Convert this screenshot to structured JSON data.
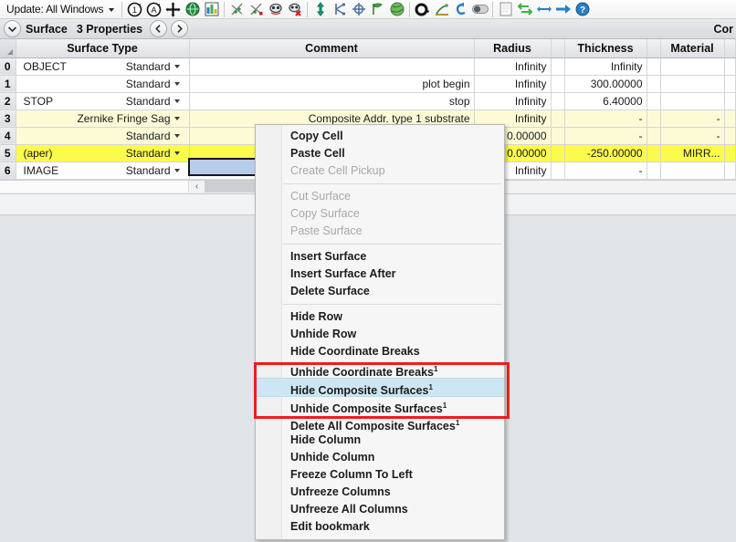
{
  "toolbar": {
    "update_label": "Update: All Windows",
    "icons": [
      {
        "name": "update-all-icon"
      },
      {
        "name": "update-all-windows-icon"
      },
      {
        "name": "move-crosshair-icon"
      },
      {
        "name": "globe-icon"
      },
      {
        "name": "layout-plot-icon"
      },
      {
        "name": "scatter-green-icon"
      },
      {
        "name": "scatter-red-icon"
      },
      {
        "name": "lens-draw-icon"
      },
      {
        "name": "lens-draw-delete-icon"
      },
      {
        "name": "ray-aim-icon"
      },
      {
        "name": "ray-split-icon"
      },
      {
        "name": "polarization-icon"
      },
      {
        "name": "flag-icon"
      },
      {
        "name": "coating-globe-icon"
      },
      {
        "name": "aperture-circle-icon"
      },
      {
        "name": "tolerance-icon"
      },
      {
        "name": "undo-icon"
      },
      {
        "name": "toggle-icon"
      },
      {
        "name": "page-icon"
      },
      {
        "name": "sync-icon"
      },
      {
        "name": "resize-icon"
      },
      {
        "name": "arrow-right-icon"
      },
      {
        "name": "help-icon"
      }
    ]
  },
  "props_bar": {
    "expand_icon": "chevron-down-icon",
    "title": "Surface",
    "subtitle": "3 Properties",
    "prev_label": "‹",
    "next_label": "›",
    "right_label": "Cor"
  },
  "table": {
    "headers": [
      "Surface Type",
      "Comment",
      "Radius",
      "Thickness",
      "Material"
    ],
    "rows": [
      {
        "num": "0",
        "name": "OBJECT",
        "type": "Standard",
        "comment": "",
        "radius": "Infinity",
        "thickness": "Infinity",
        "material": "",
        "highlight": "none"
      },
      {
        "num": "1",
        "name": "",
        "type": "Standard",
        "comment": "plot begin",
        "radius": "Infinity",
        "thickness": "300.00000",
        "material": "",
        "highlight": "none"
      },
      {
        "num": "2",
        "name": "STOP",
        "type": "Standard",
        "comment": "stop",
        "radius": "Infinity",
        "thickness": "6.40000",
        "material": "",
        "highlight": "none"
      },
      {
        "num": "3",
        "name": "",
        "type": "Zernike Fringe Sag",
        "comment": "Composite Addr. type 1 substrate",
        "radius": "Infinity",
        "thickness": "-",
        "material": "-",
        "highlight": "light"
      },
      {
        "num": "4",
        "name": "",
        "type": "Standard",
        "comment": "",
        "radius": "0.00000",
        "thickness": "-",
        "material": "-",
        "highlight": "light"
      },
      {
        "num": "5",
        "name": "(aper)",
        "type": "Standard",
        "comment": "",
        "radius": "0.00000",
        "thickness": "-250.00000",
        "material": "MIRR...",
        "highlight": "yellow"
      },
      {
        "num": "6",
        "name": "IMAGE",
        "type": "Standard",
        "comment": "",
        "radius": "Infinity",
        "thickness": "-",
        "material": "",
        "highlight": "none"
      }
    ],
    "selected_cell_text": "Composite Addr. type 1 substrate",
    "scrollbar_left_arrow": "‹"
  },
  "context_menu": [
    {
      "label": "Copy Cell",
      "style": "bold"
    },
    {
      "label": "Paste Cell",
      "style": "bold"
    },
    {
      "label": "Create Cell Pickup",
      "style": "disabled"
    },
    {
      "separator": true
    },
    {
      "label": "Cut Surface",
      "style": "disabled"
    },
    {
      "label": "Copy Surface",
      "style": "disabled"
    },
    {
      "label": "Paste Surface",
      "style": "disabled"
    },
    {
      "separator": true
    },
    {
      "label": "Insert Surface",
      "style": "bold"
    },
    {
      "label": "Insert Surface After",
      "style": "bold"
    },
    {
      "label": "Delete Surface",
      "style": "bold"
    },
    {
      "separator": true
    },
    {
      "label": "Hide Row",
      "style": "bold"
    },
    {
      "label": "Unhide Row",
      "style": "bold"
    },
    {
      "label": "Hide Coordinate Breaks",
      "style": "bold"
    },
    {
      "label": "Unhide Coordinate Breaks",
      "sup": "1",
      "style": "bold"
    },
    {
      "label": "Hide Composite Surfaces",
      "sup": "1",
      "style": "bold",
      "highlighted": true
    },
    {
      "label": "Unhide Composite Surfaces",
      "sup": "1",
      "style": "bold"
    },
    {
      "label": "Delete All Composite Surfaces",
      "sup": "1",
      "style": "bold"
    },
    {
      "label": "Hide Column",
      "style": "bold"
    },
    {
      "label": "Unhide Column",
      "style": "bold"
    },
    {
      "label": "Freeze Column To Left",
      "style": "bold"
    },
    {
      "label": "Unfreeze Columns",
      "style": "bold"
    },
    {
      "label": "Unfreeze All Columns",
      "style": "bold"
    },
    {
      "label": "Edit bookmark",
      "style": "bold"
    }
  ],
  "annotation": {
    "name": "red-highlight-box",
    "color": "#ee1c1c"
  },
  "colors": {
    "row_light_yellow": "#fcfbd6",
    "row_yellow": "#fcfa4e",
    "selection_blue": "#b8cce9",
    "menu_highlight": "#cde6f4",
    "annotation_red": "#ee1c1c"
  }
}
